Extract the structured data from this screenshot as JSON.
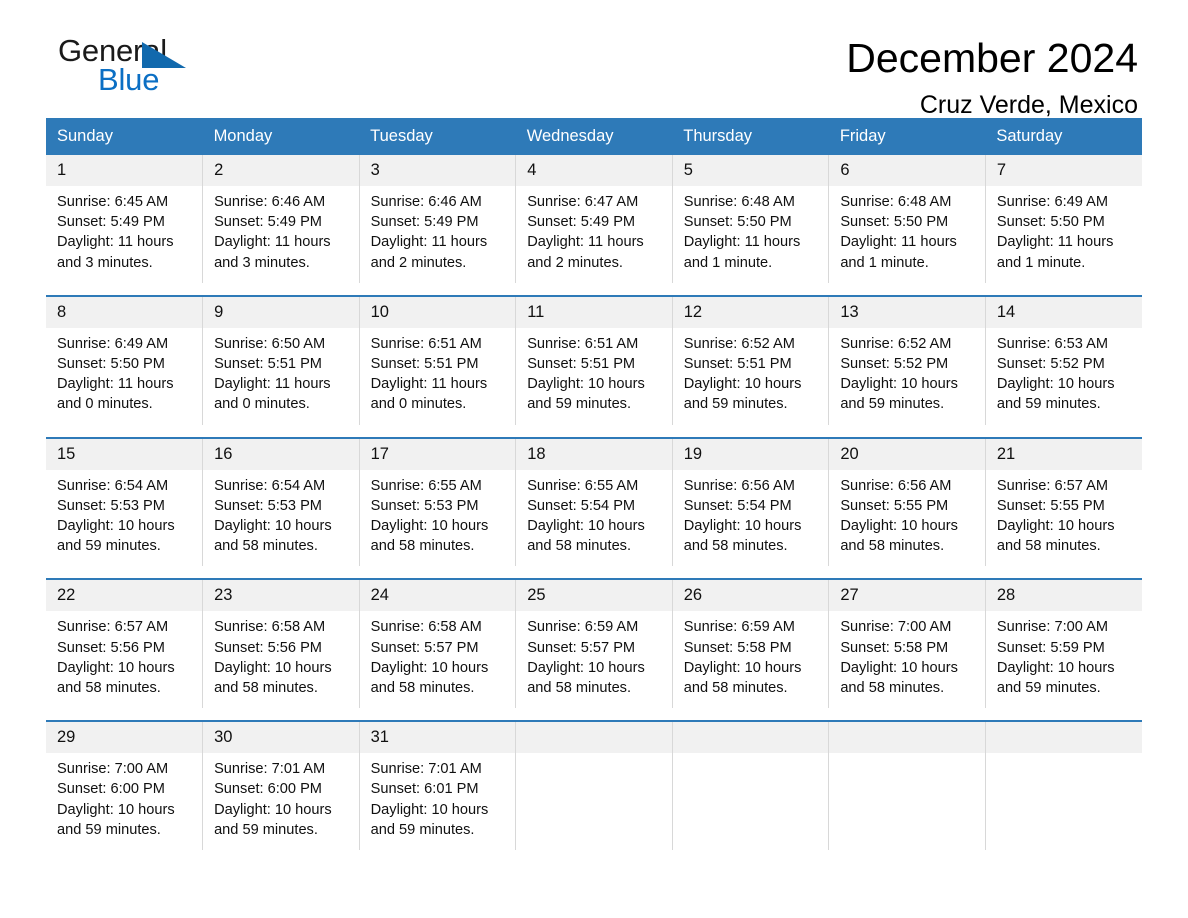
{
  "brand": {
    "name_part1": "General",
    "name_part2": "Blue",
    "triangle_color": "#1169ad",
    "blue_text_color": "#0b6fc4"
  },
  "header": {
    "title": "December 2024",
    "subtitle": "Cruz Verde, Mexico",
    "header_bg_color": "#2e7ab8",
    "daynum_bg_color": "#f1f1f1"
  },
  "calendar": {
    "weekday_headers": [
      "Sunday",
      "Monday",
      "Tuesday",
      "Wednesday",
      "Thursday",
      "Friday",
      "Saturday"
    ],
    "weeks": [
      [
        {
          "day": "1",
          "sunrise": "Sunrise: 6:45 AM",
          "sunset": "Sunset: 5:49 PM",
          "daylight_1": "Daylight: 11 hours",
          "daylight_2": "and 3 minutes."
        },
        {
          "day": "2",
          "sunrise": "Sunrise: 6:46 AM",
          "sunset": "Sunset: 5:49 PM",
          "daylight_1": "Daylight: 11 hours",
          "daylight_2": "and 3 minutes."
        },
        {
          "day": "3",
          "sunrise": "Sunrise: 6:46 AM",
          "sunset": "Sunset: 5:49 PM",
          "daylight_1": "Daylight: 11 hours",
          "daylight_2": "and 2 minutes."
        },
        {
          "day": "4",
          "sunrise": "Sunrise: 6:47 AM",
          "sunset": "Sunset: 5:49 PM",
          "daylight_1": "Daylight: 11 hours",
          "daylight_2": "and 2 minutes."
        },
        {
          "day": "5",
          "sunrise": "Sunrise: 6:48 AM",
          "sunset": "Sunset: 5:50 PM",
          "daylight_1": "Daylight: 11 hours",
          "daylight_2": "and 1 minute."
        },
        {
          "day": "6",
          "sunrise": "Sunrise: 6:48 AM",
          "sunset": "Sunset: 5:50 PM",
          "daylight_1": "Daylight: 11 hours",
          "daylight_2": "and 1 minute."
        },
        {
          "day": "7",
          "sunrise": "Sunrise: 6:49 AM",
          "sunset": "Sunset: 5:50 PM",
          "daylight_1": "Daylight: 11 hours",
          "daylight_2": "and 1 minute."
        }
      ],
      [
        {
          "day": "8",
          "sunrise": "Sunrise: 6:49 AM",
          "sunset": "Sunset: 5:50 PM",
          "daylight_1": "Daylight: 11 hours",
          "daylight_2": "and 0 minutes."
        },
        {
          "day": "9",
          "sunrise": "Sunrise: 6:50 AM",
          "sunset": "Sunset: 5:51 PM",
          "daylight_1": "Daylight: 11 hours",
          "daylight_2": "and 0 minutes."
        },
        {
          "day": "10",
          "sunrise": "Sunrise: 6:51 AM",
          "sunset": "Sunset: 5:51 PM",
          "daylight_1": "Daylight: 11 hours",
          "daylight_2": "and 0 minutes."
        },
        {
          "day": "11",
          "sunrise": "Sunrise: 6:51 AM",
          "sunset": "Sunset: 5:51 PM",
          "daylight_1": "Daylight: 10 hours",
          "daylight_2": "and 59 minutes."
        },
        {
          "day": "12",
          "sunrise": "Sunrise: 6:52 AM",
          "sunset": "Sunset: 5:51 PM",
          "daylight_1": "Daylight: 10 hours",
          "daylight_2": "and 59 minutes."
        },
        {
          "day": "13",
          "sunrise": "Sunrise: 6:52 AM",
          "sunset": "Sunset: 5:52 PM",
          "daylight_1": "Daylight: 10 hours",
          "daylight_2": "and 59 minutes."
        },
        {
          "day": "14",
          "sunrise": "Sunrise: 6:53 AM",
          "sunset": "Sunset: 5:52 PM",
          "daylight_1": "Daylight: 10 hours",
          "daylight_2": "and 59 minutes."
        }
      ],
      [
        {
          "day": "15",
          "sunrise": "Sunrise: 6:54 AM",
          "sunset": "Sunset: 5:53 PM",
          "daylight_1": "Daylight: 10 hours",
          "daylight_2": "and 59 minutes."
        },
        {
          "day": "16",
          "sunrise": "Sunrise: 6:54 AM",
          "sunset": "Sunset: 5:53 PM",
          "daylight_1": "Daylight: 10 hours",
          "daylight_2": "and 58 minutes."
        },
        {
          "day": "17",
          "sunrise": "Sunrise: 6:55 AM",
          "sunset": "Sunset: 5:53 PM",
          "daylight_1": "Daylight: 10 hours",
          "daylight_2": "and 58 minutes."
        },
        {
          "day": "18",
          "sunrise": "Sunrise: 6:55 AM",
          "sunset": "Sunset: 5:54 PM",
          "daylight_1": "Daylight: 10 hours",
          "daylight_2": "and 58 minutes."
        },
        {
          "day": "19",
          "sunrise": "Sunrise: 6:56 AM",
          "sunset": "Sunset: 5:54 PM",
          "daylight_1": "Daylight: 10 hours",
          "daylight_2": "and 58 minutes."
        },
        {
          "day": "20",
          "sunrise": "Sunrise: 6:56 AM",
          "sunset": "Sunset: 5:55 PM",
          "daylight_1": "Daylight: 10 hours",
          "daylight_2": "and 58 minutes."
        },
        {
          "day": "21",
          "sunrise": "Sunrise: 6:57 AM",
          "sunset": "Sunset: 5:55 PM",
          "daylight_1": "Daylight: 10 hours",
          "daylight_2": "and 58 minutes."
        }
      ],
      [
        {
          "day": "22",
          "sunrise": "Sunrise: 6:57 AM",
          "sunset": "Sunset: 5:56 PM",
          "daylight_1": "Daylight: 10 hours",
          "daylight_2": "and 58 minutes."
        },
        {
          "day": "23",
          "sunrise": "Sunrise: 6:58 AM",
          "sunset": "Sunset: 5:56 PM",
          "daylight_1": "Daylight: 10 hours",
          "daylight_2": "and 58 minutes."
        },
        {
          "day": "24",
          "sunrise": "Sunrise: 6:58 AM",
          "sunset": "Sunset: 5:57 PM",
          "daylight_1": "Daylight: 10 hours",
          "daylight_2": "and 58 minutes."
        },
        {
          "day": "25",
          "sunrise": "Sunrise: 6:59 AM",
          "sunset": "Sunset: 5:57 PM",
          "daylight_1": "Daylight: 10 hours",
          "daylight_2": "and 58 minutes."
        },
        {
          "day": "26",
          "sunrise": "Sunrise: 6:59 AM",
          "sunset": "Sunset: 5:58 PM",
          "daylight_1": "Daylight: 10 hours",
          "daylight_2": "and 58 minutes."
        },
        {
          "day": "27",
          "sunrise": "Sunrise: 7:00 AM",
          "sunset": "Sunset: 5:58 PM",
          "daylight_1": "Daylight: 10 hours",
          "daylight_2": "and 58 minutes."
        },
        {
          "day": "28",
          "sunrise": "Sunrise: 7:00 AM",
          "sunset": "Sunset: 5:59 PM",
          "daylight_1": "Daylight: 10 hours",
          "daylight_2": "and 59 minutes."
        }
      ],
      [
        {
          "day": "29",
          "sunrise": "Sunrise: 7:00 AM",
          "sunset": "Sunset: 6:00 PM",
          "daylight_1": "Daylight: 10 hours",
          "daylight_2": "and 59 minutes."
        },
        {
          "day": "30",
          "sunrise": "Sunrise: 7:01 AM",
          "sunset": "Sunset: 6:00 PM",
          "daylight_1": "Daylight: 10 hours",
          "daylight_2": "and 59 minutes."
        },
        {
          "day": "31",
          "sunrise": "Sunrise: 7:01 AM",
          "sunset": "Sunset: 6:01 PM",
          "daylight_1": "Daylight: 10 hours",
          "daylight_2": "and 59 minutes."
        },
        {
          "day": "",
          "sunrise": "",
          "sunset": "",
          "daylight_1": "",
          "daylight_2": ""
        },
        {
          "day": "",
          "sunrise": "",
          "sunset": "",
          "daylight_1": "",
          "daylight_2": ""
        },
        {
          "day": "",
          "sunrise": "",
          "sunset": "",
          "daylight_1": "",
          "daylight_2": ""
        },
        {
          "day": "",
          "sunrise": "",
          "sunset": "",
          "daylight_1": "",
          "daylight_2": ""
        }
      ]
    ]
  }
}
